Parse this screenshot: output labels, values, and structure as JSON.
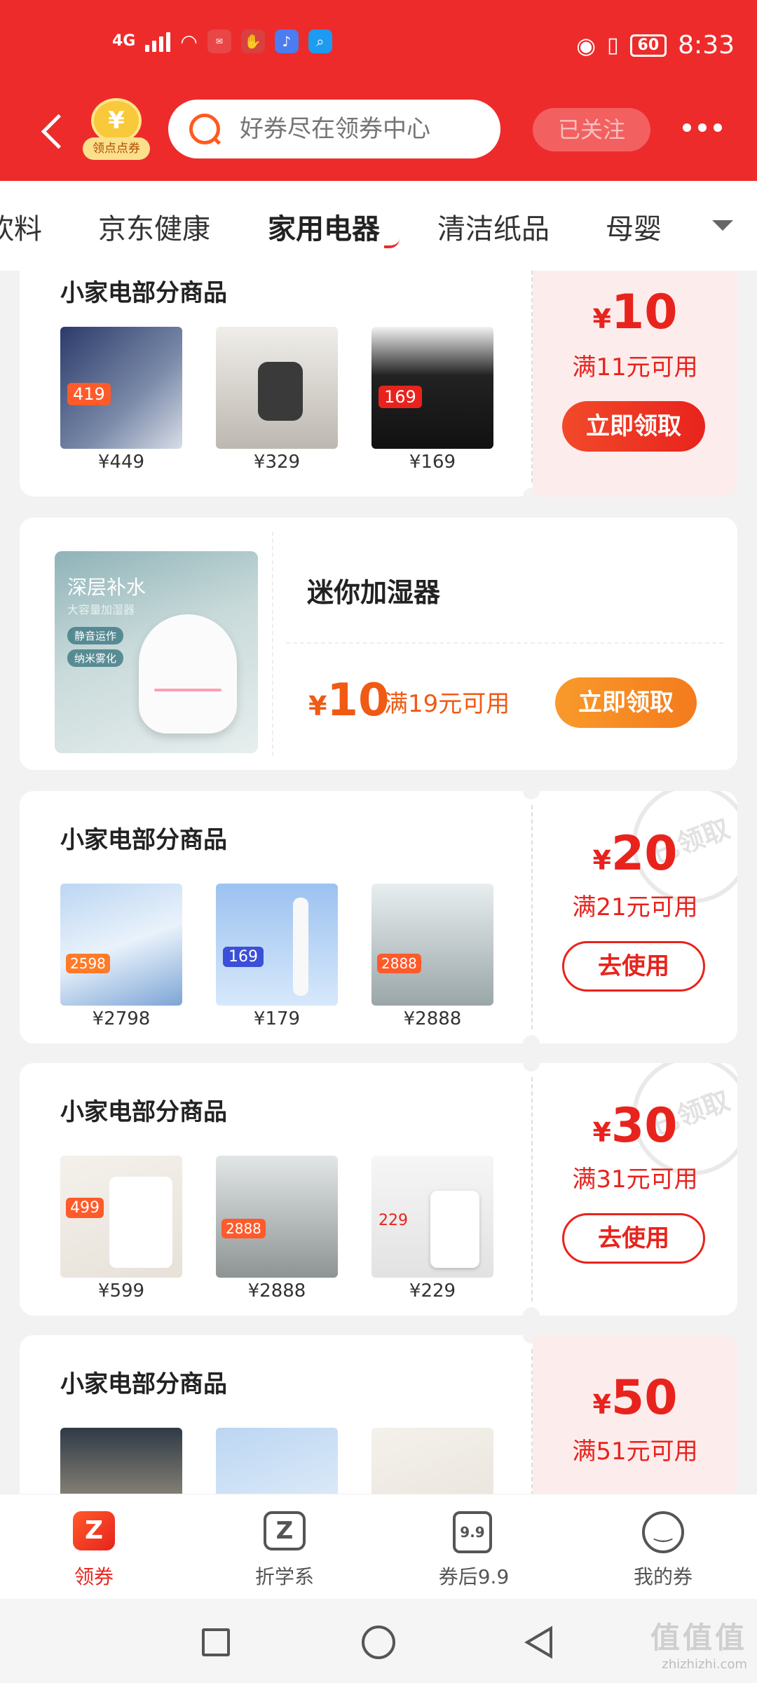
{
  "status_bar": {
    "network": "4G",
    "battery": "60",
    "time": "8:33"
  },
  "header": {
    "coin_label": "领点点券",
    "coin_symbol": "¥",
    "search_placeholder": "好券尽在领券中心",
    "follow_label": "已关注"
  },
  "tabs": [
    "饮料",
    "京东健康",
    "家用电器",
    "清洁纸品",
    "母婴"
  ],
  "active_tab": "家用电器",
  "cards": [
    {
      "title": "小家电部分商品",
      "prices": [
        "¥449",
        "¥329",
        "¥169"
      ],
      "amount": "10",
      "condition": "满11元可用",
      "button": "立即领取",
      "claimed": false
    },
    {
      "name": "迷你加湿器",
      "amount": "10",
      "condition": "满19元可用",
      "button": "立即领取",
      "image_text": {
        "t1": "深层补水",
        "t2": "大容量加湿器",
        "c1": "静音运作",
        "c2": "纳米雾化"
      }
    },
    {
      "title": "小家电部分商品",
      "prices": [
        "¥2798",
        "¥179",
        "¥2888"
      ],
      "amount": "20",
      "condition": "满21元可用",
      "button": "去使用",
      "stamp": "已领取",
      "claimed": true
    },
    {
      "title": "小家电部分商品",
      "prices": [
        "¥599",
        "¥2888",
        "¥229"
      ],
      "amount": "30",
      "condition": "满31元可用",
      "button": "去使用",
      "stamp": "已领取",
      "claimed": true
    },
    {
      "title": "小家电部分商品",
      "prices": [],
      "amount": "50",
      "condition": "满51元可用",
      "claimed": false
    }
  ],
  "currency_symbol": "¥",
  "bottom_nav": [
    {
      "label": "领券",
      "icon": "coupon-icon",
      "active": true
    },
    {
      "label": "折学系",
      "icon": "z-icon",
      "active": false
    },
    {
      "label": "券后9.9",
      "icon": "ticket-icon",
      "icon_text": "9.9",
      "active": false
    },
    {
      "label": "我的券",
      "icon": "smile-icon",
      "active": false
    }
  ],
  "watermark": {
    "line1": "值值值",
    "line2": "zhizhizhi.com"
  },
  "colors": {
    "brand_red": "#ee2b2b",
    "coupon_red": "#e8231d",
    "orange": "#f47b1d"
  }
}
